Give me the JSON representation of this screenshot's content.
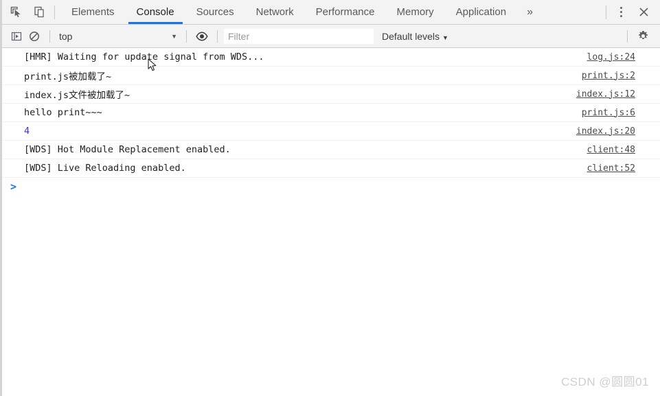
{
  "window": {
    "title": "Chrome DevTools - Console"
  },
  "tabbar": {
    "inspect_icon": "inspect-element-icon",
    "device_icon": "device-toolbar-icon",
    "tabs": [
      {
        "label": "Elements",
        "active": false
      },
      {
        "label": "Console",
        "active": true
      },
      {
        "label": "Sources",
        "active": false
      },
      {
        "label": "Network",
        "active": false
      },
      {
        "label": "Performance",
        "active": false
      },
      {
        "label": "Memory",
        "active": false
      },
      {
        "label": "Application",
        "active": false
      }
    ],
    "overflow_label": "»",
    "more_options_icon": "kebab-menu-icon",
    "close_icon": "close-icon"
  },
  "filterbar": {
    "sidebar_toggle_icon": "console-sidebar-icon",
    "clear_icon": "clear-console-icon",
    "context": {
      "value": "top",
      "caret": "▼"
    },
    "eye_icon": "eye-icon",
    "filter": {
      "value": "",
      "placeholder": "Filter"
    },
    "levels": {
      "label": "Default levels",
      "caret": "▼"
    },
    "settings_icon": "gear-icon"
  },
  "console": {
    "messages": [
      {
        "text": "[HMR] Waiting for update signal from WDS...",
        "link": "log.js:24",
        "type": "log"
      },
      {
        "text": "print.js被加载了~",
        "link": "print.js:2",
        "type": "log"
      },
      {
        "text": "index.js文件被加载了~",
        "link": "index.js:12",
        "type": "log"
      },
      {
        "text": "hello print~~~",
        "link": "print.js:6",
        "type": "log"
      },
      {
        "text": "4",
        "link": "index.js:20",
        "type": "number"
      },
      {
        "text": "[WDS] Hot Module Replacement enabled.",
        "link": "client:48",
        "type": "log"
      },
      {
        "text": "[WDS] Live Reloading enabled.",
        "link": "client:52",
        "type": "log"
      }
    ],
    "prompt": {
      "caret": ">",
      "value": ""
    }
  },
  "watermark": {
    "text": "CSDN @圆圆01"
  },
  "colors": {
    "accent": "#1a73e8",
    "number": "#3b32d0",
    "toolbar_bg": "#f3f3f3",
    "body_bg": "#ffffff",
    "link": "#4a4a4a",
    "watermark": "#cfcfcf"
  }
}
